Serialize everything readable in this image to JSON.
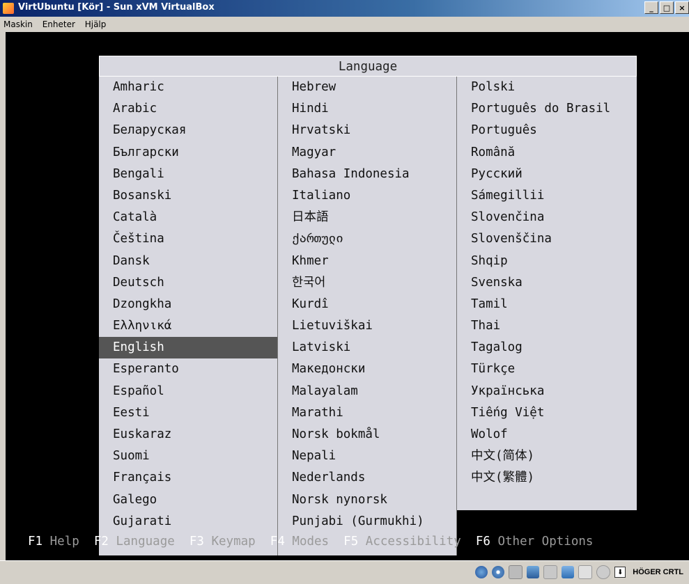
{
  "window": {
    "title": "VirtUbuntu [Kör] - Sun xVM VirtualBox",
    "minimize": "_",
    "maximize": "□",
    "close": "×"
  },
  "menu": {
    "items": [
      "Maskin",
      "Enheter",
      "Hjälp"
    ]
  },
  "dialog": {
    "title": "Language",
    "selected": "English",
    "columns": [
      [
        "Amharic",
        "Arabic",
        "Беларуская",
        "Български",
        "Bengali",
        "Bosanski",
        "Català",
        "Čeština",
        "Dansk",
        "Deutsch",
        "Dzongkha",
        "Ελληνικά",
        "English",
        "Esperanto",
        "Español",
        "Eesti",
        "Euskaraz",
        "Suomi",
        "Français",
        "Galego",
        "Gujarati"
      ],
      [
        "Hebrew",
        "Hindi",
        "Hrvatski",
        "Magyar",
        "Bahasa Indonesia",
        "Italiano",
        "日本語",
        "ქართული",
        "Khmer",
        "한국어",
        "Kurdî",
        "Lietuviškai",
        "Latviski",
        "Македонски",
        "Malayalam",
        "Marathi",
        "Norsk bokmål",
        "Nepali",
        "Nederlands",
        "Norsk nynorsk",
        "Punjabi (Gurmukhi)"
      ],
      [
        "Polski",
        "Português do Brasil",
        "Português",
        "Română",
        "Русский",
        "Sámegillii",
        "Slovenčina",
        "Slovenščina",
        "Shqip",
        "Svenska",
        "Tamil",
        "Thai",
        "Tagalog",
        "Türkçe",
        "Українська",
        "Tiếng Việt",
        "Wolof",
        "中文(简体)",
        "中文(繁體)"
      ]
    ]
  },
  "function_keys": [
    {
      "key": "F1",
      "label": "Help"
    },
    {
      "key": "F2",
      "label": "Language"
    },
    {
      "key": "F3",
      "label": "Keymap"
    },
    {
      "key": "F4",
      "label": "Modes"
    },
    {
      "key": "F5",
      "label": "Accessibility"
    },
    {
      "key": "F6",
      "label": "Other Options"
    }
  ],
  "status": {
    "host_key": "HÖGER CRTL",
    "icons": [
      "harddisk-icon",
      "cdrom-icon",
      "floppy-icon",
      "network-icon",
      "usb-icon",
      "shared-folder-icon",
      "display-icon",
      "mouse-integration-icon",
      "host-key-icon"
    ],
    "colors": {
      "accent": "#0a246a"
    }
  }
}
